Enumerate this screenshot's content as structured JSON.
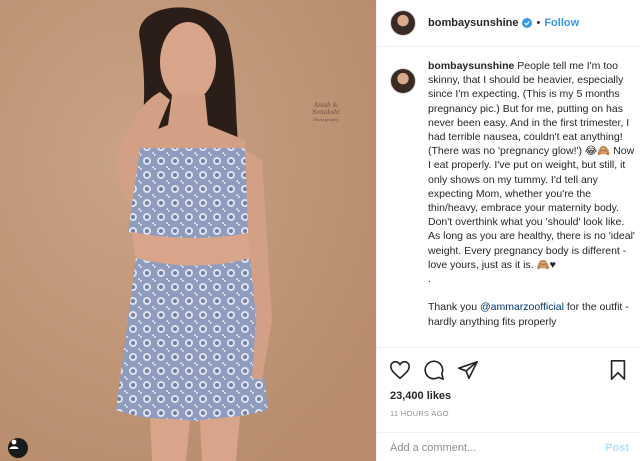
{
  "post": {
    "username": "bombaysunshine",
    "follow_label": "Follow",
    "dot": "•",
    "caption_username": "bombaysunshine",
    "caption_text": "People tell me I'm too skinny, that I should be heavier, especially since I'm expecting. (This is my 5 months pregnancy pic.) But for me, putting on has never been easy. And in the first trimester, I had terrible nausea, couldn't eat anything! (There was no 'pregnancy glow!') 😂🙈 Now I eat properly. I've put on weight, but still, it only shows on my tummy. I'd tell any expecting Mom, whether you're the thin/heavy, embrace your maternity body. Don't overthink what you 'should' look like. As long as you are healthy, there is no 'ideal' weight. Every pregnancy body is different - love yours, just as it is. 🙈♥",
    "caption_separator": ".",
    "thanks_prefix": "Thank you ",
    "thanks_mention": "@ammarzoofficial",
    "thanks_suffix": " for the outfit - hardly anything fits properly",
    "likes": "23,400 likes",
    "timestamp": "11 HOURS AGO"
  },
  "photo": {
    "watermark_line1": "Anish & Sonakshi",
    "watermark_line2": "Photography"
  },
  "comment": {
    "placeholder": "Add a comment...",
    "post_label": "Post"
  },
  "icons": {
    "verified": "verified-badge-icon",
    "like": "heart-icon",
    "comment": "comment-bubble-icon",
    "share": "paper-plane-icon",
    "save": "bookmark-icon",
    "tag": "person-tag-icon"
  },
  "colors": {
    "accent": "#3897f0",
    "background_photo": "#c49a7c",
    "border": "#efefef",
    "muted": "#8e8e8e",
    "post_disabled": "#b2dffc"
  }
}
